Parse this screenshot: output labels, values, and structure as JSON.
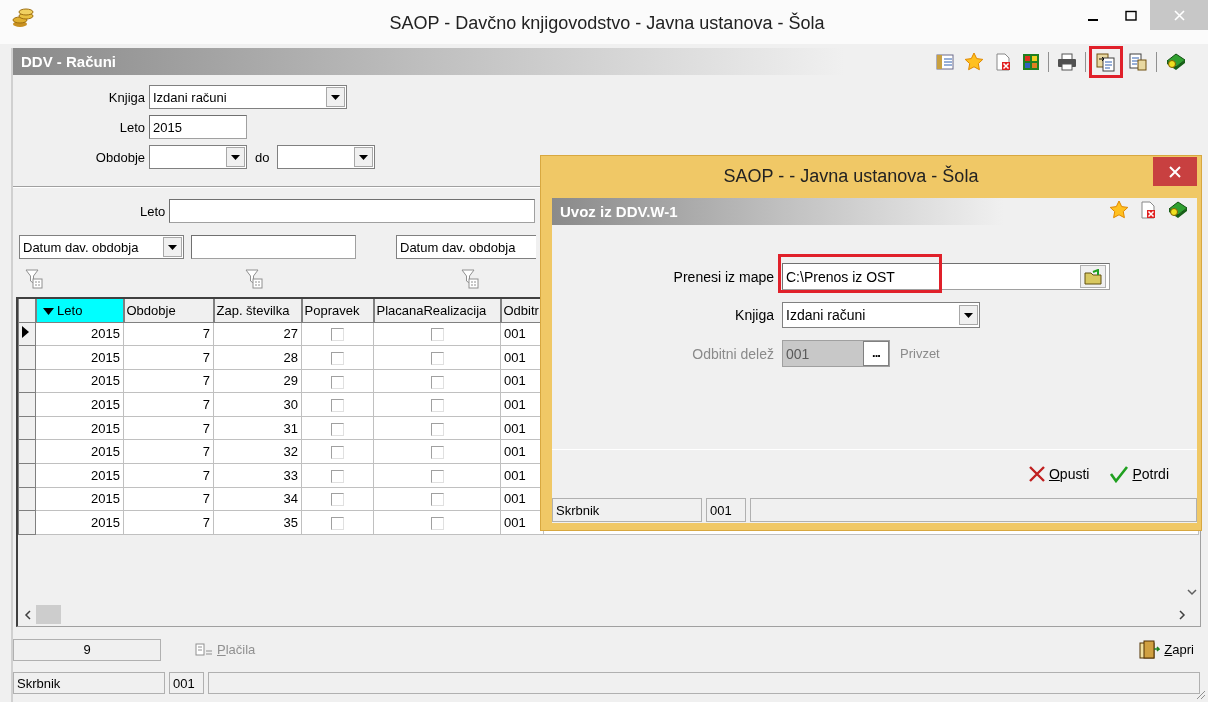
{
  "window": {
    "title": "SAOP -  Davčno knjigovodstvo - Javna ustanova - Šola"
  },
  "form_header": {
    "title": "DDV - Računi"
  },
  "toolbar": [
    {
      "kind": "columns",
      "highlighted": false
    },
    {
      "kind": "favorite",
      "highlighted": false
    },
    {
      "kind": "delete",
      "highlighted": false
    },
    {
      "kind": "grid",
      "highlighted": false
    },
    {
      "kind": "print",
      "highlighted": false
    },
    {
      "kind": "import",
      "highlighted": true
    },
    {
      "kind": "export",
      "highlighted": false
    },
    {
      "kind": "help",
      "highlighted": false
    }
  ],
  "filters": {
    "book": {
      "label": "Knjiga",
      "value": "Izdani računi"
    },
    "year": {
      "label": "Leto",
      "value": "2015"
    },
    "period": {
      "label": "Obdobje",
      "to_label": "do"
    }
  },
  "search": {
    "year_label": "Leto",
    "field_1": "Datum dav. obdobja",
    "field_2": "Datum dav. obdobja"
  },
  "table": {
    "columns": [
      {
        "label": "Leto",
        "sorted": true
      },
      {
        "label": "Obdobje",
        "sorted": false
      },
      {
        "label": "Zap. številka",
        "sorted": false
      },
      {
        "label": "Popravek",
        "sorted": false
      },
      {
        "label": "PlacanaRealizacija",
        "sorted": false
      },
      {
        "label": "Odbitr",
        "sorted": false
      }
    ],
    "rows": [
      {
        "selected": true,
        "leto": "2015",
        "obdobje": "7",
        "number": "27",
        "popravek": false,
        "placana": false,
        "odbitni": "001"
      },
      {
        "selected": false,
        "leto": "2015",
        "obdobje": "7",
        "number": "28",
        "popravek": false,
        "placana": false,
        "odbitni": "001"
      },
      {
        "selected": false,
        "leto": "2015",
        "obdobje": "7",
        "number": "29",
        "popravek": false,
        "placana": false,
        "odbitni": "001"
      },
      {
        "selected": false,
        "leto": "2015",
        "obdobje": "7",
        "number": "30",
        "popravek": false,
        "placana": false,
        "odbitni": "001"
      },
      {
        "selected": false,
        "leto": "2015",
        "obdobje": "7",
        "number": "31",
        "popravek": false,
        "placana": false,
        "odbitni": "001"
      },
      {
        "selected": false,
        "leto": "2015",
        "obdobje": "7",
        "number": "32",
        "popravek": false,
        "placana": false,
        "odbitni": "001"
      },
      {
        "selected": false,
        "leto": "2015",
        "obdobje": "7",
        "number": "33",
        "popravek": false,
        "placana": false,
        "odbitni": "001"
      },
      {
        "selected": false,
        "leto": "2015",
        "obdobje": "7",
        "number": "34",
        "popravek": false,
        "placana": false,
        "odbitni": "001"
      },
      {
        "selected": false,
        "leto": "2015",
        "obdobje": "7",
        "number": "35",
        "popravek": false,
        "placana": false,
        "odbitni": "001"
      }
    ]
  },
  "footer": {
    "count": "9",
    "payments_button": {
      "label": "Plačila",
      "disabled": true
    },
    "close_button": "Zapri"
  },
  "status_bar": [
    "Skrbnik",
    "001"
  ],
  "dialog": {
    "title": "SAOP -   - Javna ustanova - Šola",
    "header": "Uvoz iz DDV.W-1",
    "toolbar": [
      {
        "kind": "favorite"
      },
      {
        "kind": "delete"
      },
      {
        "kind": "help"
      }
    ],
    "folder": {
      "label": "Prenesi iz mape",
      "value": "C:\\Prenos iz OST",
      "highlighted": true
    },
    "book": {
      "label": "Knjiga",
      "value": "Izdani računi"
    },
    "share": {
      "label": "Odbitni delež",
      "value": "001",
      "browse": "...",
      "note": "Privzet",
      "disabled": true
    },
    "buttons": [
      {
        "kind": "cancel",
        "label": "Opusti"
      },
      {
        "kind": "confirm",
        "label": "Potrdi"
      }
    ],
    "status_bar": [
      "Skrbnik",
      "001"
    ]
  }
}
